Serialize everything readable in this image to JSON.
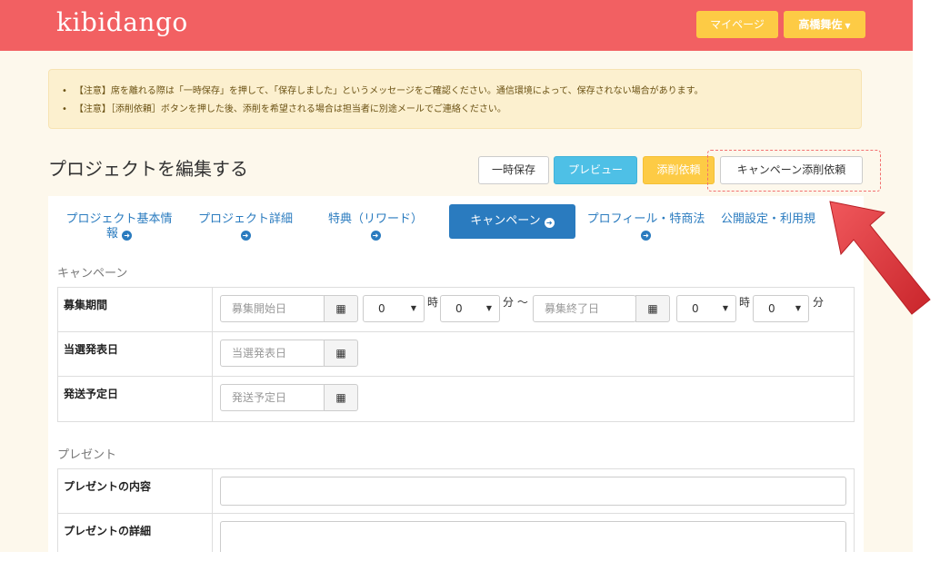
{
  "header": {
    "logo": "kibidango",
    "mypage_label": "マイページ",
    "user_label": "高橋舞佐"
  },
  "notice": {
    "items": [
      "【注意】席を離れる際は「一時保存」を押して、「保存しました」というメッセージをご確認ください。通信環境によって、保存されない場合があります。",
      "【注意】［添削依頼］ボタンを押した後、添削を希望される場合は担当者に別途メールでご連絡ください。"
    ]
  },
  "page": {
    "title": "プロジェクトを編集する"
  },
  "toolbar": {
    "save_label": "一時保存",
    "preview_label": "プレビュー",
    "review_label": "添削依頼",
    "campaign_review_label": "キャンペーン添削依頼"
  },
  "tabs": [
    {
      "label": "プロジェクト基本情報",
      "active": false
    },
    {
      "label": "プロジェクト詳細",
      "active": false
    },
    {
      "label": "特典（リワード）",
      "active": false
    },
    {
      "label": "キャンペーン",
      "active": true
    },
    {
      "label": "プロフィール・特商法",
      "active": false
    },
    {
      "label": "公開設定・利用規",
      "active": false
    }
  ],
  "campaign_section": {
    "title": "キャンペーン",
    "period_label": "募集期間",
    "start_placeholder": "募集開始日",
    "end_placeholder": "募集終了日",
    "hour_value": "0",
    "minute_value": "0",
    "hour_unit": "時",
    "minute_unit": "分",
    "range_sep": "分 ～",
    "announce_label": "当選発表日",
    "announce_placeholder": "当選発表日",
    "ship_label": "発送予定日",
    "ship_placeholder": "発送予定日"
  },
  "present_section": {
    "title": "プレゼント",
    "content_label": "プレゼントの内容",
    "detail_label": "プレゼントの詳細"
  },
  "colors": {
    "header": "#f26062",
    "accent_yellow": "#fdcb45",
    "accent_blue": "#2a7bbf",
    "preview": "#4ec0e6",
    "arrow": "#e2373c"
  }
}
